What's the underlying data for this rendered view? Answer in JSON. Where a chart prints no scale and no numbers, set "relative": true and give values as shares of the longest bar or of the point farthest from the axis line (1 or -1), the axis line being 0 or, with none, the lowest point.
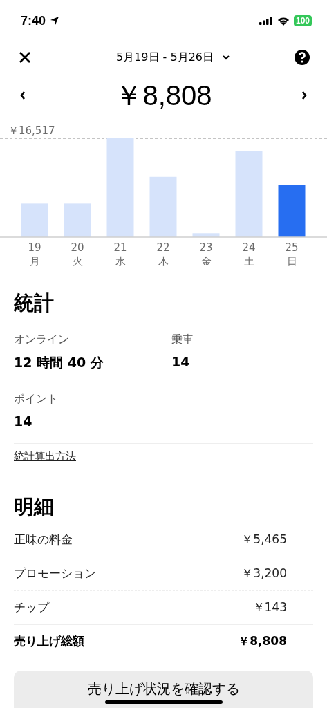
{
  "status_bar": {
    "time": "7:40",
    "battery": "100"
  },
  "header": {
    "date_range": "5月19日 - 5月26日",
    "total": "￥8,808"
  },
  "chart_data": {
    "type": "bar",
    "relative": true,
    "categories": [
      "19\n月",
      "20\n火",
      "21\n水",
      "22\n木",
      "23\n金",
      "24\n土",
      "25\n日"
    ],
    "stacked": true,
    "annotations": [
      {
        "text": "￥16,517"
      }
    ],
    "series": [
      {
        "color": "#d6e3fb",
        "values": [
          0.34,
          0.34,
          1,
          0.61,
          0.04,
          0.87,
          null
        ]
      },
      {
        "color": "#276ef1",
        "values": [
          null,
          null,
          null,
          null,
          null,
          null,
          0.53
        ]
      }
    ]
  },
  "stats": {
    "title": "統計",
    "items": [
      {
        "label": "オンライン",
        "value": "12 時間 40 分"
      },
      {
        "label": "乗車",
        "value": "14"
      },
      {
        "label": "ポイント",
        "value": "14"
      }
    ],
    "link": "統計算出方法"
  },
  "breakdown": {
    "title": "明細",
    "rows": [
      {
        "label": "正味の料金",
        "value": "￥5,465",
        "kind": "line"
      },
      {
        "label": "プロモーション",
        "value": "￥3,200",
        "kind": "line"
      },
      {
        "label": "チップ",
        "value": "￥143",
        "kind": "line"
      },
      {
        "label": "売り上げ総額",
        "value": "￥8,808",
        "kind": "total"
      }
    ]
  },
  "button": "売り上げ状況を確認する"
}
